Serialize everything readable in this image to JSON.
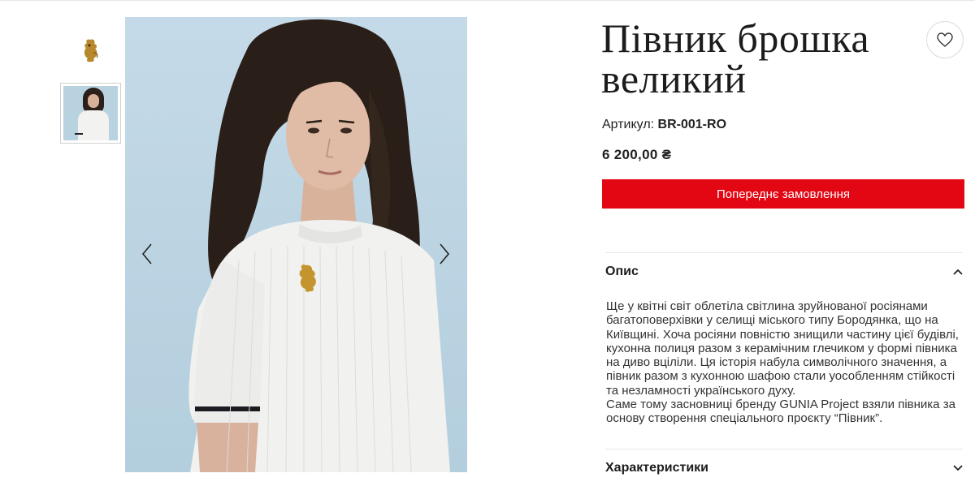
{
  "product": {
    "title_line1": "Півник брошка",
    "title_line2": "великий",
    "sku_label": "Артикул:",
    "sku_value": "BR-001-RO",
    "price": "6 200,00 ₴",
    "order_button": "Попереднє замовлення"
  },
  "gallery": {
    "thumbnails": [
      "brooch-thumbnail",
      "model-thumbnail"
    ],
    "selected_index": 1,
    "prev_icon": "chevron-left-icon",
    "next_icon": "chevron-right-icon"
  },
  "favorite": {
    "icon": "heart-icon"
  },
  "accordion": {
    "description": {
      "label": "Опис",
      "expanded": true,
      "paragraph1": "Ще у квітні світ облетіла світлина зруйнованої росіянами багатоповерхівки у селищі міського типу Бородянка, що на Київщині. Хоча росіяни повністю знищили частину цієї будівлі, кухонна полиця разом з керамічним глечиком у формі півника на диво вціліли. Ця історія набула символічного значення, а півник разом з кухонною шафою стали уособленням стійкості та незламності українського духу.",
      "paragraph2": "Саме тому засновниці бренду GUNIA Project взяли півника за основу створення спеціального проєкту “Півник”."
    },
    "characteristics": {
      "label": "Характеристики",
      "expanded": false
    }
  },
  "colors": {
    "accent": "#e30613",
    "image_background": "#bfd6e4"
  }
}
